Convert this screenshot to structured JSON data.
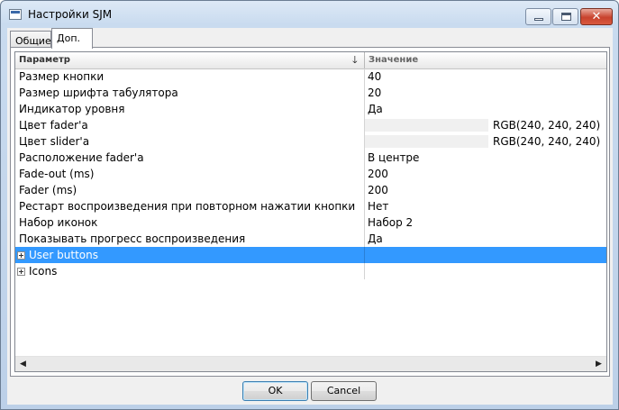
{
  "window": {
    "title": "Настройки SJM"
  },
  "tabs": [
    {
      "label": "Общие",
      "active": false
    },
    {
      "label": "Доп.",
      "active": true
    }
  ],
  "grid": {
    "columns": {
      "param": "Параметр",
      "value": "Значение"
    },
    "rows": [
      {
        "name": "Размер кнопки",
        "value": "40"
      },
      {
        "name": "Размер шрифта табулятора",
        "value": "20"
      },
      {
        "name": "Индикатор уровня",
        "value": "Да"
      },
      {
        "name": "Цвет fader'a",
        "value": "RGB(240, 240, 240)",
        "color": "#f0f0f0"
      },
      {
        "name": "Цвет slider'a",
        "value": "RGB(240, 240, 240)",
        "color": "#f0f0f0"
      },
      {
        "name": "Расположение fader'a",
        "value": "В центре"
      },
      {
        "name": "Fade-out (ms)",
        "value": "200"
      },
      {
        "name": "Fader (ms)",
        "value": "200"
      },
      {
        "name": "Рестарт воспроизведения при повторном нажатии кнопки",
        "value": "Нет"
      },
      {
        "name": "Набор иконок",
        "value": "Набор 2"
      },
      {
        "name": "Показывать прогресс воспроизведения",
        "value": "Да"
      }
    ],
    "categories": [
      {
        "label": "User buttons",
        "selected": true
      },
      {
        "label": "Icons",
        "selected": false
      }
    ]
  },
  "buttons": {
    "ok": "OK",
    "cancel": "Cancel"
  },
  "colors": {
    "selection": "#3399ff",
    "title_bar": "#c9dbef"
  }
}
